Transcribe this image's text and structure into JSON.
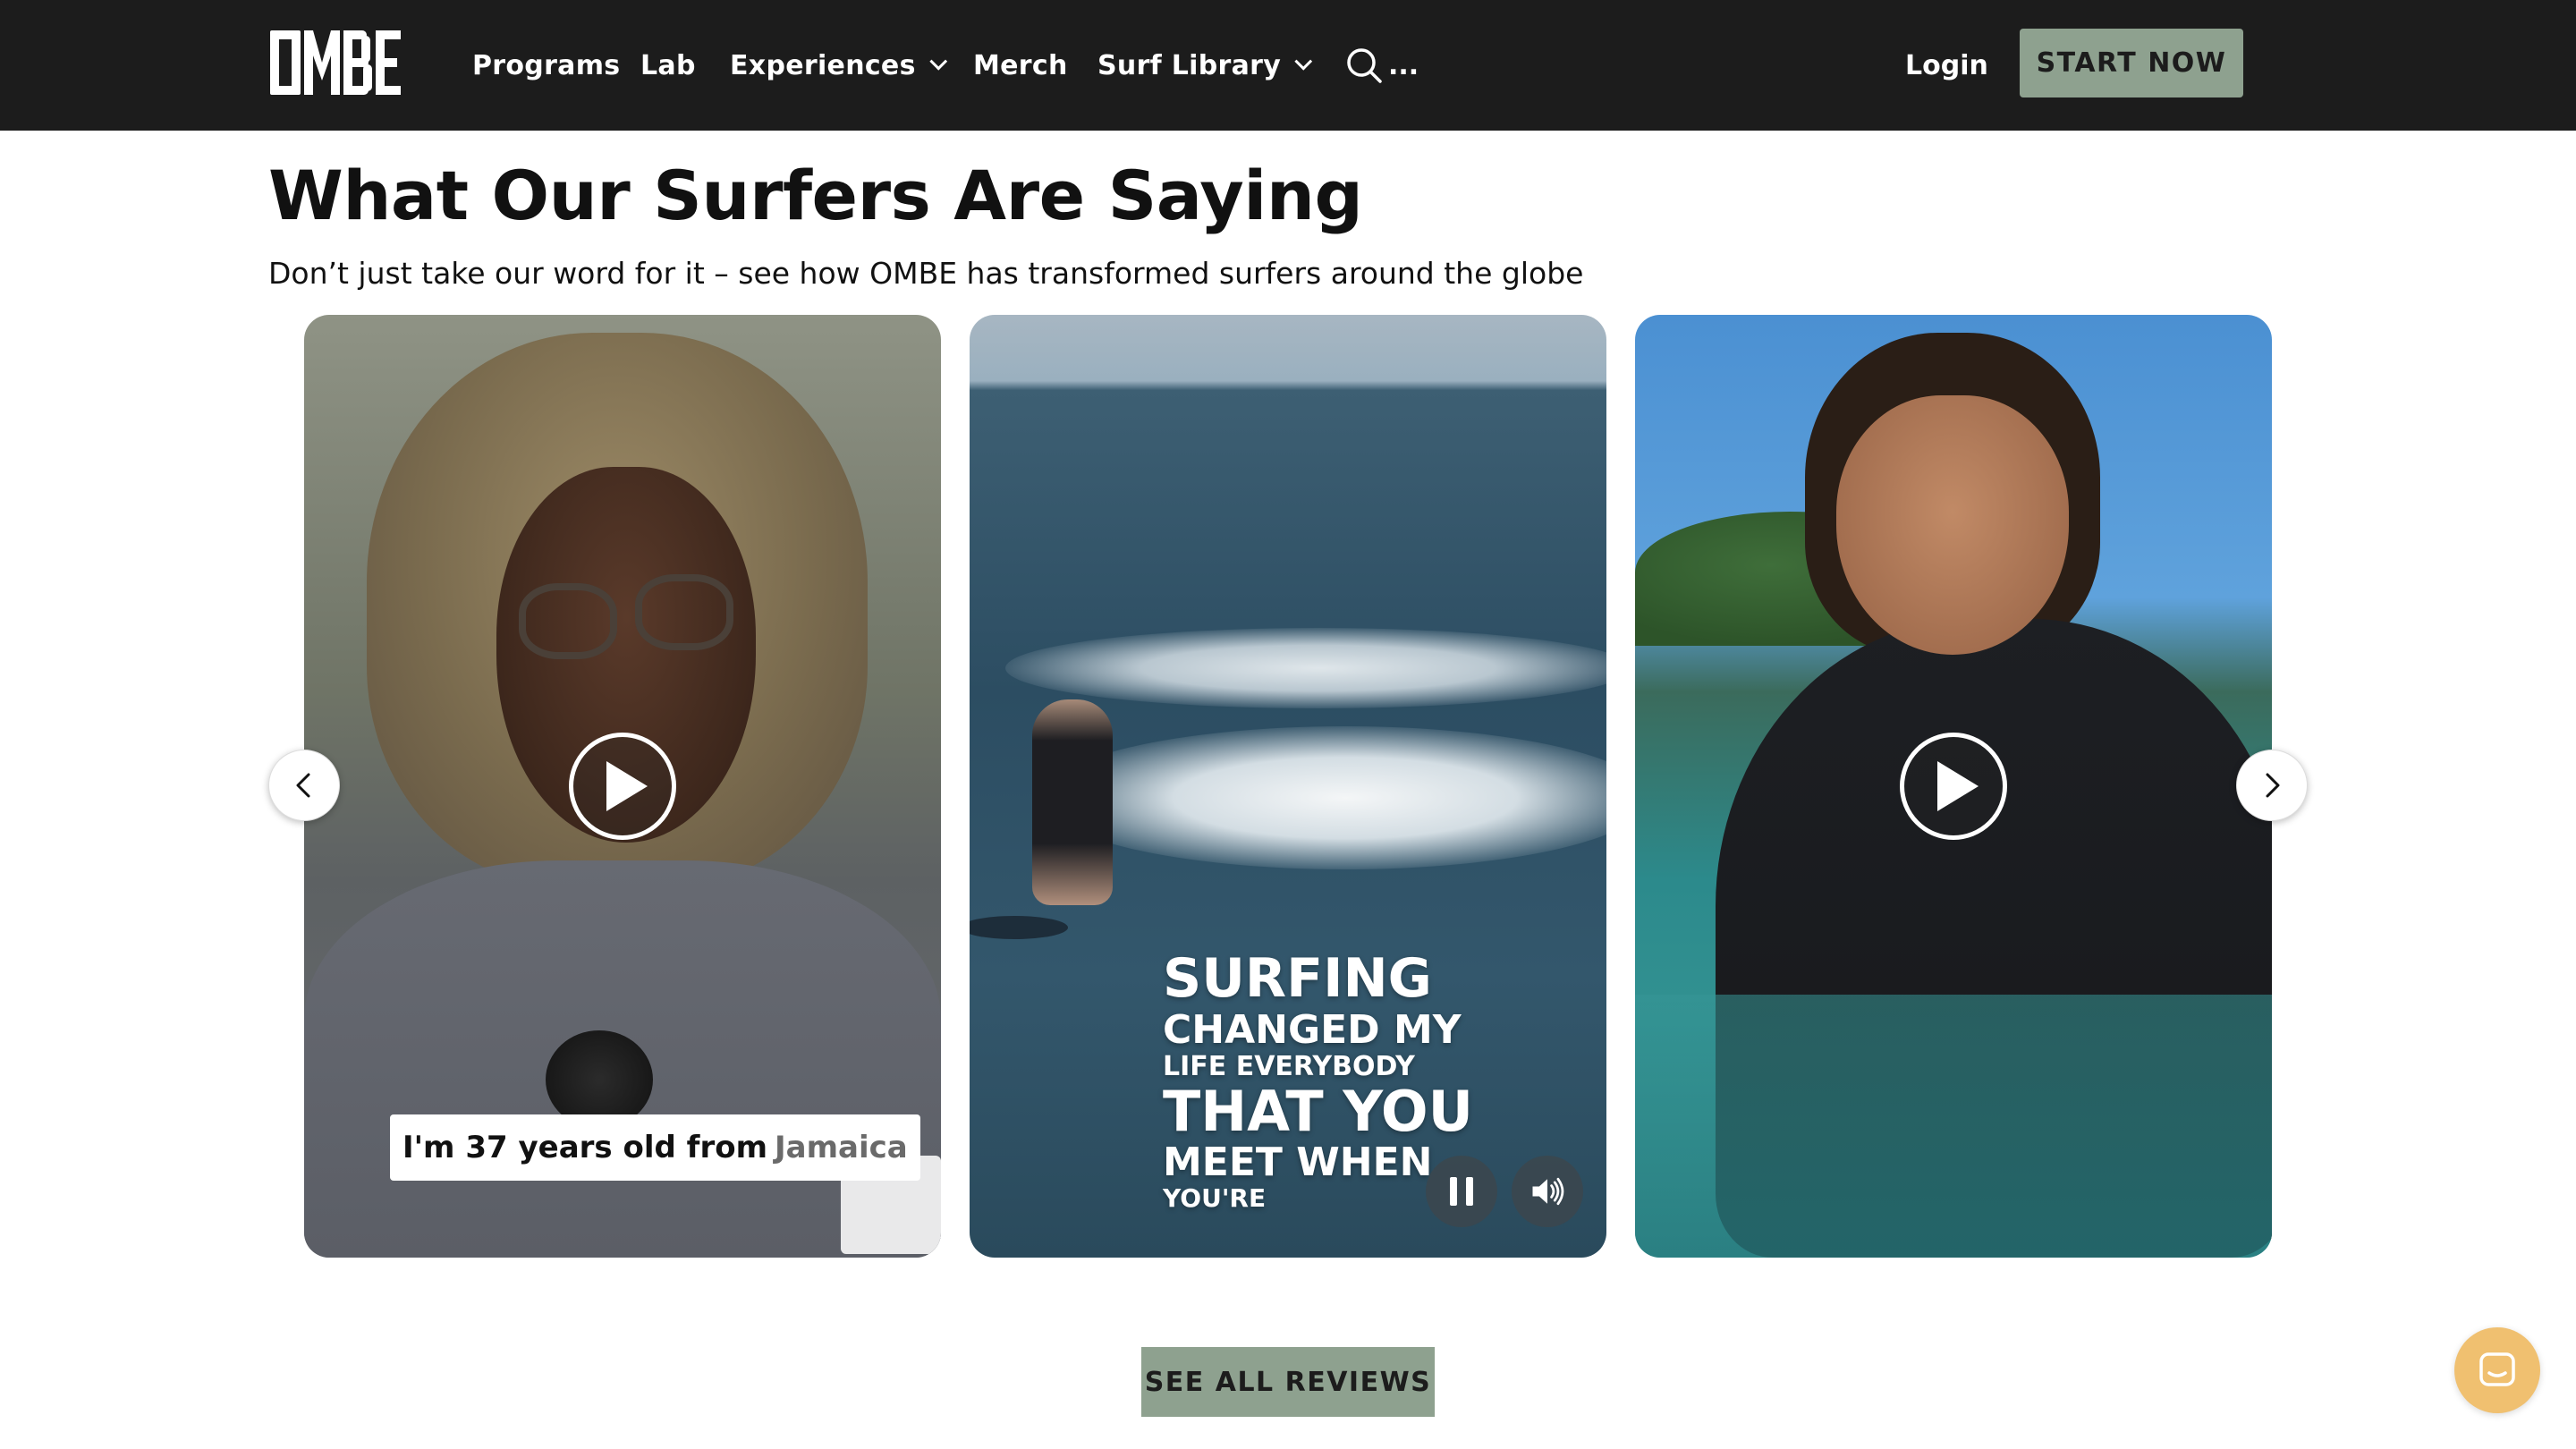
{
  "header": {
    "logo_text": "OMBE",
    "nav": [
      {
        "label": "Programs",
        "has_dropdown": false
      },
      {
        "label": "Lab",
        "has_dropdown": false
      },
      {
        "label": "Experiences",
        "has_dropdown": true
      },
      {
        "label": "Merch",
        "has_dropdown": false
      },
      {
        "label": "Surf Library",
        "has_dropdown": true
      }
    ],
    "search_label": "...",
    "login_label": "Login",
    "cta_label": "START NOW",
    "colors": {
      "bar": "#1c1c1c",
      "cta": "#8ea18f"
    }
  },
  "section": {
    "title": "What Our Surfers Are Saying",
    "subtitle": "Don’t just take our word for it – see how OMBE has transformed surfers around the globe"
  },
  "videos": [
    {
      "caption_main": "I'm 37 years old from",
      "caption_highlight": "Jamaica",
      "state": "paused"
    },
    {
      "overlay_lines": [
        "SURFING",
        "CHANGED MY",
        "LIFE EVERYBODY",
        "THAT YOU",
        "MEET WHEN",
        "YOU'RE"
      ],
      "state": "playing",
      "controls": [
        "pause-icon",
        "volume-icon"
      ]
    },
    {
      "state": "paused"
    }
  ],
  "carousel": {
    "prev_icon": "chevron-left-icon",
    "next_icon": "chevron-right-icon"
  },
  "footer": {
    "see_all_label": "SEE ALL REVIEWS",
    "chat_icon": "chat-icon",
    "chat_color": "#f0c070"
  }
}
